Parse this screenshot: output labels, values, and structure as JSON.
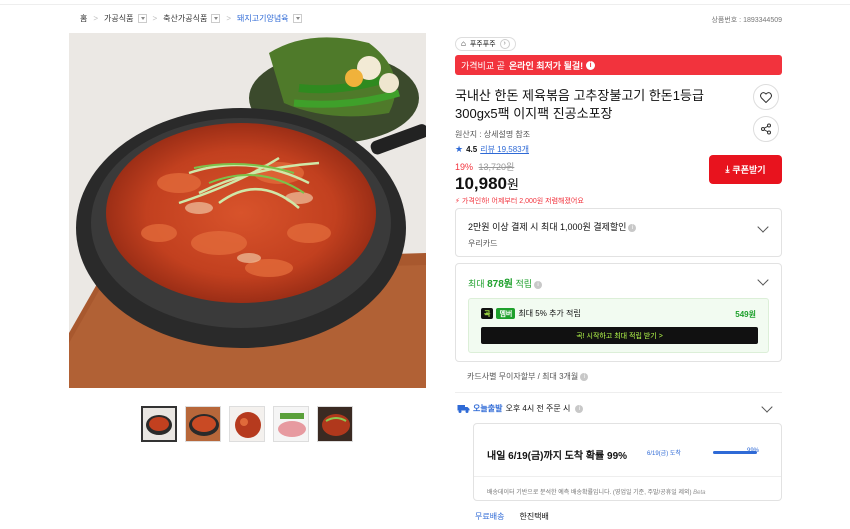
{
  "breadcrumb": {
    "home": "홈",
    "cat1": "가공식품",
    "cat2": "축산가공식품",
    "cat3": "돼지고기양념육"
  },
  "product_number": "상품번호 : 1893344509",
  "store": {
    "name": "푸주푸주"
  },
  "price_banner": {
    "prefix": "가격비교 곧",
    "emphasis": "온라인 최저가 될걸!"
  },
  "product": {
    "title": "국내산 한돈 제육볶음 고추장불고기 한돈1등급 300gx5팩 이지팩 진공소포장",
    "origin": "원산지 : 상세설명 참조",
    "rating": "4.5",
    "reviews": "리뷰 19,583개",
    "discount": "19%",
    "original_price": "13,720원",
    "price": "10,980",
    "price_unit": "원",
    "promo": "가격인하! 어제부터 2,000원 저렴해졌어요"
  },
  "coupon": {
    "label": "쿠폰받기"
  },
  "card_benefit": {
    "title": "2만원 이상 결제 시 최대 1,000원 결제할인",
    "sub": "우리카드"
  },
  "points": {
    "prefix": "최대",
    "amount": "878원",
    "suffix": "적립",
    "badge1": "곡",
    "badge2": "멤버",
    "member_text": "최대 5% 추가 적립",
    "member_amount": "549원",
    "cta": "곡! 시작하고 최대 적립 받기 >"
  },
  "installment": {
    "text": "카드사별 무이자할부 / 최대 3개월"
  },
  "delivery": {
    "brand": "오늘출발",
    "time": "오후 4시 전 주문 시",
    "arrival": "내일 6/19(금)까지 도착 확률 99%",
    "bar_label": "6/19(금) 도착",
    "bar_pct": "99%",
    "bar_fill": 0.99,
    "note": "배송데이터 기반으로 분석한 예측 배송확률입니다. (영업일 기준, 주말/공휴일 제외)",
    "beta": "Beta"
  },
  "shipping": {
    "free": "무료배송",
    "carrier": "한진택배"
  },
  "colors": {
    "accent_red": "#f2333d",
    "coupon_red": "#e8131e",
    "blue": "#2f6ad6",
    "green": "#1ea02c"
  },
  "icons": [
    "chevron-right-icon",
    "heart-icon",
    "share-icon",
    "star-icon",
    "download-icon",
    "info-icon",
    "chevron-down-icon",
    "truck-icon"
  ]
}
